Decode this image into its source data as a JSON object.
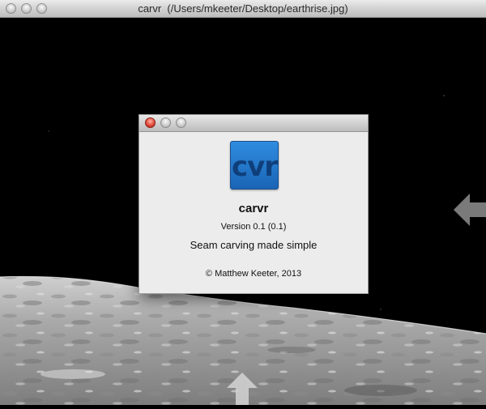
{
  "window": {
    "title": "carvr  (/Users/mkeeter/Desktop/earthrise.jpg)"
  },
  "image": {
    "description_icon": "moon-surface-photo"
  },
  "handles": {
    "right_icon": "arrow-left-icon",
    "bottom_icon": "arrow-up-icon",
    "color": "#7a7a7a"
  },
  "about": {
    "app_icon_text": "cvr",
    "app_name": "carvr",
    "version": "Version 0.1 (0.1)",
    "tagline": "Seam carving made simple",
    "copyright": "© Matthew Keeter, 2013"
  },
  "colors": {
    "icon_blue": "#1f73c8",
    "close_red": "#e24b3c"
  }
}
